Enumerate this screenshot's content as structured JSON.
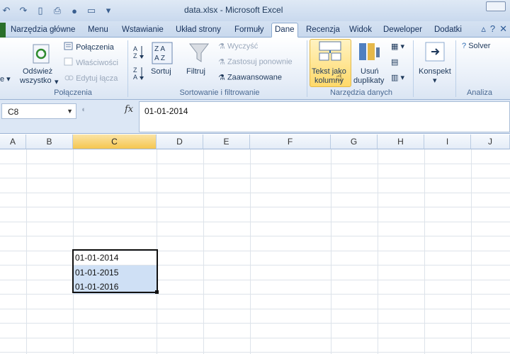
{
  "window": {
    "title": "data.xlsx  -  Microsoft Excel"
  },
  "tabs": [
    "Narzędzia główne",
    "Menu",
    "Wstawianie",
    "Układ strony",
    "Formuły",
    "Dane",
    "Recenzja",
    "Widok",
    "Deweloper",
    "Dodatki"
  ],
  "active_tab": "Dane",
  "ribbon": {
    "refresh_label_1": "Odśwież",
    "refresh_label_2": "wszystko",
    "connections": "Połączenia",
    "properties": "Właściwości",
    "edit_links": "Edytuj łącza",
    "group_connections": "Połączenia",
    "sort": "Sortuj",
    "filter": "Filtruj",
    "clear": "Wyczyść",
    "reapply": "Zastosuj ponownie",
    "advanced": "Zaawansowane",
    "group_sort": "Sortowanie i filtrowanie",
    "text_to_columns_1": "Tekst jako",
    "text_to_columns_2": "kolumny",
    "remove_dup_1": "Usuń",
    "remove_dup_2": "duplikaty",
    "group_datatools": "Narzędzia danych",
    "outline": "Konspekt",
    "solver": "Solver",
    "group_analysis": "Analiza"
  },
  "formula_bar": {
    "cell_ref": "C8",
    "fx": "fx",
    "value": "01-01-2014"
  },
  "columns": [
    "A",
    "B",
    "C",
    "D",
    "E",
    "F",
    "G",
    "H",
    "I",
    "J"
  ],
  "selected_column": "C",
  "cells": [
    "01-01-2014",
    "01-01-2015",
    "01-01-2016"
  ],
  "colors": {
    "accent_tab": "#2a6f2a",
    "selection": "#cfe0f5",
    "col_select": "#f5c64f"
  }
}
